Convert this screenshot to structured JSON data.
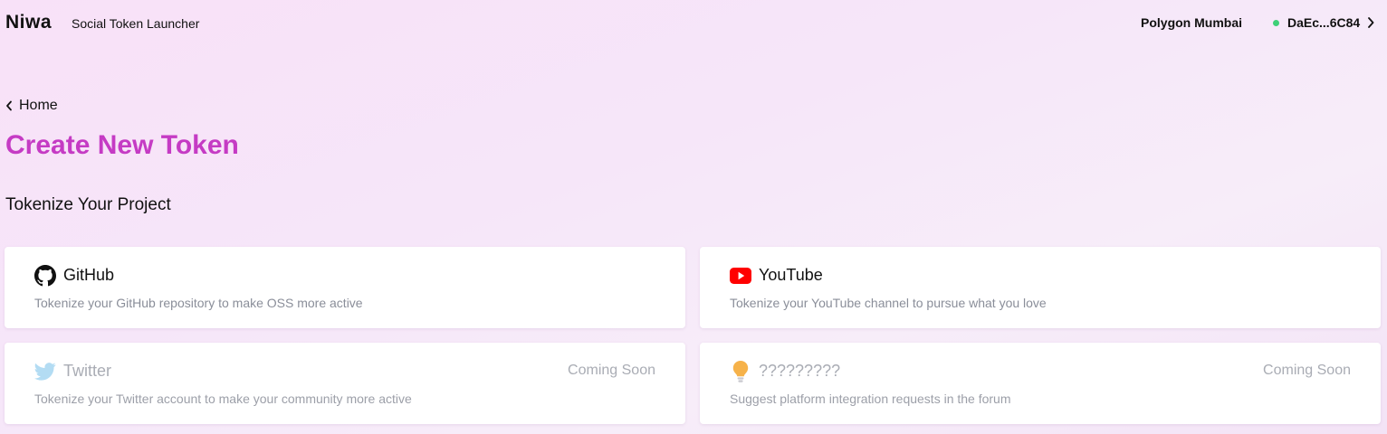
{
  "header": {
    "logo": "Niwa",
    "subtitle": "Social Token Launcher",
    "network": "Polygon Mumbai",
    "wallet_address": "DaEc...6C84",
    "wallet_status_color": "#3ed078"
  },
  "breadcrumb": {
    "back_label": "Home",
    "icon": "chevron-left-icon"
  },
  "page_title": "Create New Token",
  "section_title": "Tokenize Your Project",
  "accent_color": "#c53bc4",
  "platforms": [
    {
      "name": "GitHub",
      "description": "Tokenize your GitHub repository to make OSS more active",
      "icon": "github-icon",
      "enabled": true
    },
    {
      "name": "YouTube",
      "description": "Tokenize your YouTube channel to pursue what you love",
      "icon": "youtube-icon",
      "enabled": true
    },
    {
      "name": "Twitter",
      "description": "Tokenize your Twitter account to make your community more active",
      "icon": "twitter-icon",
      "enabled": false,
      "badge": "Coming Soon"
    },
    {
      "name": "?????????",
      "description": "Suggest platform integration requests in the forum",
      "icon": "lightbulb-icon",
      "enabled": false,
      "badge": "Coming Soon"
    }
  ]
}
